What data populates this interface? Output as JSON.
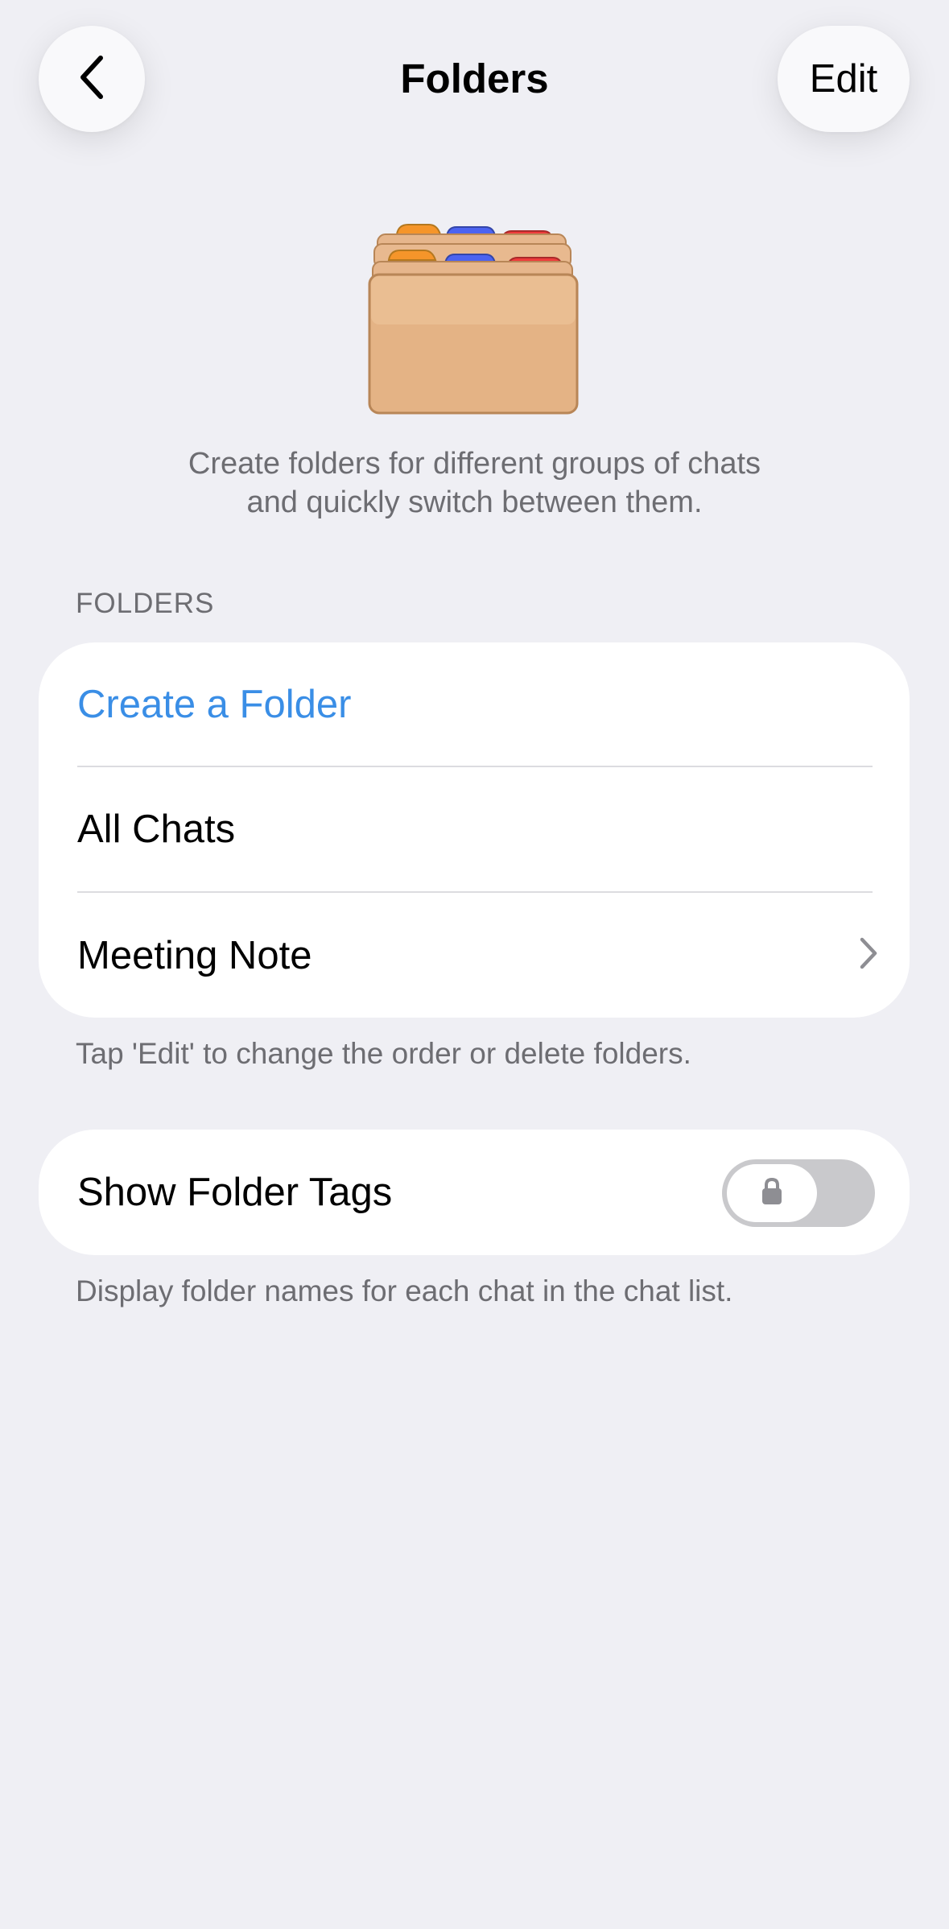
{
  "nav": {
    "title": "Folders",
    "edit_label": "Edit",
    "back_icon": "chevron-left-icon"
  },
  "hero": {
    "icon": "folders-illustration",
    "tab_colors": [
      "#f5952a",
      "#4c63f0",
      "#ef3b3b"
    ],
    "description_line1": "Create folders for different groups of chats",
    "description_line2": "and quickly switch between them."
  },
  "folders_section": {
    "header": "FOLDERS",
    "items": [
      {
        "label": "Create a Folder",
        "accent": "#3a8ee6"
      },
      {
        "label": "All Chats"
      },
      {
        "label": "Meeting Note",
        "icon": "chevron-right-icon"
      }
    ],
    "footer": "Tap 'Edit' to change the order or delete folders."
  },
  "tags_section": {
    "label": "Show Folder Tags",
    "toggle_on": false,
    "toggle_locked": true,
    "lock_icon": "lock-icon",
    "footer": "Display folder names for each chat in the chat list."
  }
}
